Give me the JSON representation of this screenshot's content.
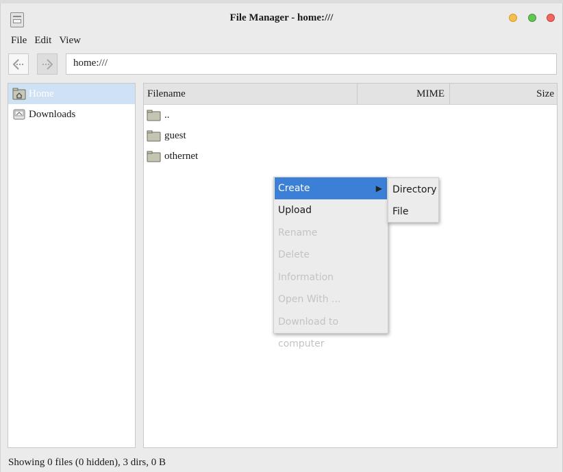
{
  "window": {
    "title": "File Manager - home:///"
  },
  "menubar": {
    "items": [
      "File",
      "Edit",
      "View"
    ]
  },
  "toolbar": {
    "address": "home:///"
  },
  "sidebar": {
    "items": [
      {
        "label": "Home",
        "icon": "home-folder-icon",
        "selected": true
      },
      {
        "label": "Downloads",
        "icon": "downloads-drive-icon",
        "selected": false
      }
    ]
  },
  "files": {
    "columns": [
      "Filename",
      "MIME",
      "Size"
    ],
    "rows": [
      {
        "name": "..",
        "icon": "folder-icon"
      },
      {
        "name": "guest",
        "icon": "folder-icon"
      },
      {
        "name": "othernet",
        "icon": "folder-icon"
      }
    ]
  },
  "context_menu": {
    "items": [
      {
        "label": "Create",
        "enabled": true,
        "active": true,
        "has_submenu": true
      },
      {
        "label": "Upload",
        "enabled": true
      },
      {
        "label": "Rename",
        "enabled": false
      },
      {
        "label": "Delete",
        "enabled": false
      },
      {
        "label": "Information",
        "enabled": false
      },
      {
        "label": "Open With ...",
        "enabled": false
      },
      {
        "label": "Download to computer",
        "enabled": false
      }
    ],
    "submenu": [
      "Directory",
      "File"
    ]
  },
  "status": {
    "text": "Showing 0 files (0 hidden), 3 dirs, 0 B"
  },
  "colors": {
    "selection": "#3b7fd6",
    "sidebar_selected": "#cfe1f5",
    "disabled_text": "#c3c3c3"
  }
}
